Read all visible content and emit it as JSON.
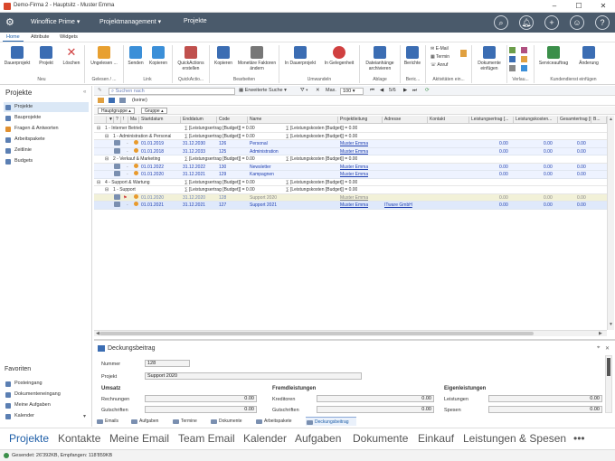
{
  "window": {
    "title": "Demo-Firma 2 - Hauptsitz - Muster Emma",
    "min": "–",
    "max": "☐",
    "close": "✕"
  },
  "header": {
    "app": "Winoffice Prime",
    "module": "Projektmanagement",
    "page": "Projekte"
  },
  "ribbon_tabs": [
    "Home",
    "Attribute",
    "Widgets"
  ],
  "ribbon": {
    "buttons": [
      {
        "label": "Dauerprojekt",
        "color": "#3b6db3"
      },
      {
        "label": "Projekt",
        "color": "#3b6db3"
      },
      {
        "label": "Löschen",
        "color": "#d04040"
      },
      {
        "label": "Ungelesen ...",
        "color": "#e8a030"
      },
      {
        "label": "Senden",
        "color": "#3b8fd8"
      },
      {
        "label": "Kopieren",
        "color": "#3b8fd8"
      },
      {
        "label": "QuickActions erstellen",
        "color": "#c0504d"
      },
      {
        "label": "Kopieren",
        "color": "#3b6db3"
      },
      {
        "label": "Monetäre Faktoren ändern",
        "color": "#777777"
      },
      {
        "label": "In Dauerprojekt",
        "color": "#3b6db3"
      },
      {
        "label": "In Gelegenheit",
        "color": "#d04040"
      },
      {
        "label": "Dateianhänge archivieren",
        "color": "#3b6db3"
      },
      {
        "label": "Berichte",
        "color": "#3b6db3"
      },
      {
        "label": "Dokumente einfügen",
        "color": "#3b6db3"
      },
      {
        "label": "Serviceauftrag",
        "color": "#3b8f4a"
      },
      {
        "label": "Änderung",
        "color": "#3b6db3"
      }
    ],
    "small": [
      "E-Mail",
      "Termin",
      "Anruf"
    ],
    "groups": [
      "Neu",
      "Gelesen / ...",
      "Link",
      "QuickActio...",
      "Bearbeiten",
      "Umwandeln",
      "Ablage",
      "Beric...",
      "Aktivitäten ein...",
      "Verlau...",
      "Kundendienst einfügen"
    ]
  },
  "leftnav": {
    "title": "Projekte",
    "items": [
      "Projekte",
      "Bauprojekte",
      "Fragen & Antworten",
      "Arbeitspakete",
      "Zeitlinie",
      "Budgets"
    ],
    "favorites_title": "Favoriten",
    "favorites": [
      "Posteingang",
      "Dokumenteneingang",
      "Meine Aufgaben",
      "Kalender"
    ]
  },
  "toolbar": {
    "search_placeholder": "Suchen nach",
    "advanced_search": "Erweiterte Suche",
    "max_label": "Max.",
    "max_value": "100",
    "page": "5/6",
    "filter_value": "(keine)"
  },
  "grouping": [
    "Hauptgruppe",
    "Gruppe"
  ],
  "columns": [
    "Ma",
    "Startdatum",
    "Enddatum",
    "Code",
    "Name",
    "Projektleitung",
    "Adresse",
    "Kontakt",
    "Leistungsertrag [...",
    "Leistungskosten...",
    "Gesamtertrag [B...",
    "B..."
  ],
  "rows": [
    {
      "type": "g1",
      "label": "1 - Interner Betrieb",
      "sum1": "∑ [Leistungsertrag [Budget]] = 0.00",
      "sum2": "∑ [Leistungskosten [Budget]] = 0.00"
    },
    {
      "type": "g2",
      "label": "1 - Administration & Personal",
      "sum1": "∑ [Leistungsertrag [Budget]] = 0.00",
      "sum2": "∑ [Leistungskosten [Budget]] = 0.00"
    },
    {
      "type": "d",
      "start": "01.01.2019",
      "end": "31.12.2030",
      "code": "126",
      "name": "Personal",
      "lead": "Muster Emma",
      "addr": "",
      "v1": "0.00",
      "v2": "0.00",
      "v3": "0.00"
    },
    {
      "type": "d",
      "start": "01.01.2018",
      "end": "31.12.2033",
      "code": "125",
      "name": "Administration",
      "lead": "Muster Emma",
      "addr": "",
      "v1": "0.00",
      "v2": "0.00",
      "v3": "0.00"
    },
    {
      "type": "g2",
      "label": "2 - Verkauf & Marketing",
      "sum1": "∑ [Leistungsertrag [Budget]] = 0.00",
      "sum2": "∑ [Leistungskosten [Budget]] = 0.00"
    },
    {
      "type": "d",
      "start": "01.01.2022",
      "end": "31.12.2022",
      "code": "130",
      "name": "Newsletter",
      "lead": "Muster Emma",
      "addr": "",
      "v1": "0.00",
      "v2": "0.00",
      "v3": "0.00"
    },
    {
      "type": "d",
      "start": "01.01.2020",
      "end": "31.12.2021",
      "code": "129",
      "name": "Kampagnen",
      "lead": "Muster Emma",
      "addr": "",
      "v1": "0.00",
      "v2": "0.00",
      "v3": "0.00"
    },
    {
      "type": "g1",
      "label": "4 - Support & Wartung",
      "sum1": "∑ [Leistungsertrag [Budget]] = 0.00",
      "sum2": "∑ [Leistungskosten [Budget]] = 0.00"
    },
    {
      "type": "g2",
      "label": "1 - Support",
      "sum1": "∑ [Leistungsertrag [Budget]] = 0.00",
      "sum2": "∑ [Leistungskosten [Budget]] = 0.00"
    },
    {
      "type": "sel",
      "start": "01.01.2020",
      "end": "31.12.2020",
      "code": "128",
      "name": "Support 2020",
      "lead": "Muster Emma",
      "addr": "",
      "v1": "0.00",
      "v2": "0.00",
      "v3": "0.00"
    },
    {
      "type": "d",
      "start": "01.01.2021",
      "end": "31.12.2021",
      "code": "127",
      "name": "Support 2021",
      "lead": "Muster Emma",
      "addr": "ITware GmbH",
      "v1": "0.00",
      "v2": "0.00",
      "v3": "0.00"
    }
  ],
  "detail": {
    "title": "Deckungsbeitrag",
    "nummer_label": "Nummer",
    "nummer": "128",
    "projekt_label": "Projekt",
    "projekt": "Support 2020",
    "umsatz": "Umsatz",
    "rechnungen": "Rechnungen",
    "gutschriften": "Gutschriften",
    "fremd": "Fremdleistungen",
    "kreditoren": "Kreditoren",
    "fremd_gutschriften": "Gutschriften",
    "eigen": "Eigenleistungen",
    "leistungen": "Leistungen",
    "spesen": "Spesen",
    "zero": "0.00",
    "tabs": [
      "Emails",
      "Aufgaben",
      "Termine",
      "Dokumente",
      "Arbeitspakete",
      "Deckungsbeitrag"
    ]
  },
  "bottomnav": [
    "Projekte",
    "Kontakte",
    "Meine Email",
    "Team Email",
    "Kalender",
    "Aufgaben",
    "Dokumente",
    "Einkauf",
    "Leistungen & Spesen",
    "•••"
  ],
  "status": "Gesendet: 26'392KB, Empfangen: 118'859KB"
}
